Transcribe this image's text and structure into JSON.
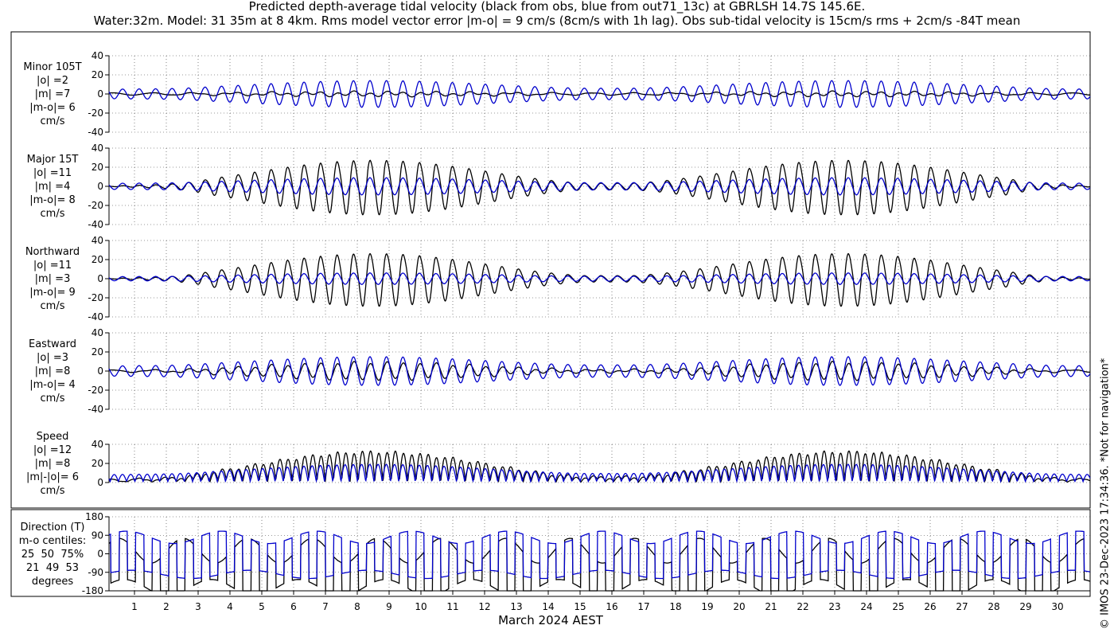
{
  "title_line1": "Predicted depth-average tidal velocity (black from obs, blue from out71_13c) at GBRLSH 14.7S 145.6E.",
  "title_line2": "Water:32m. Model: 31 35m at 8 4km. Rms model vector error |m-o| = 9 cm/s (8cm/s with 1h lag). Obs sub-tidal velocity is 15cm/s rms + 2cm/s -84T mean",
  "credit": "© IMOS 23-Dec-2023 17:34:36. *Not for navigation*",
  "colors": {
    "obs": "#000000",
    "model": "#0000cc",
    "grid": "#333333"
  },
  "chart_data": {
    "type": "line",
    "xlabel": "March 2024 AEST",
    "x_ticks": [
      "1",
      "2",
      "3",
      "4",
      "5",
      "6",
      "7",
      "8",
      "9",
      "10",
      "11",
      "12",
      "13",
      "14",
      "15",
      "16",
      "17",
      "18",
      "19",
      "20",
      "21",
      "22",
      "23",
      "24",
      "25",
      "26",
      "27",
      "28",
      "29",
      "30"
    ],
    "series_names": {
      "obs": "obs",
      "model": "out71_13c"
    },
    "panels": [
      {
        "key": "minor",
        "label": [
          "Minor 105T",
          "|o| =2",
          "|m| =7",
          "|m-o|= 6",
          "cm/s"
        ],
        "ylim": [
          -40,
          40
        ],
        "yticks": [
          "40",
          "20",
          "0",
          "-20",
          "-40"
        ],
        "obs_amp": 2,
        "model_amp": 14
      },
      {
        "key": "major",
        "label": [
          "Major 15T",
          "|o| =11",
          "|m| =4",
          "|m-o|= 8",
          "cm/s"
        ],
        "ylim": [
          -40,
          40
        ],
        "yticks": [
          "40",
          "20",
          "0",
          "-20",
          "-40"
        ],
        "obs_amp": 28,
        "model_amp": 9
      },
      {
        "key": "northward",
        "label": [
          "Northward",
          "|o| =11",
          "|m| =3",
          "|m-o|= 9",
          "cm/s"
        ],
        "ylim": [
          -40,
          40
        ],
        "yticks": [
          "40",
          "20",
          "0",
          "-20",
          "-40"
        ],
        "obs_amp": 27,
        "model_amp": 6
      },
      {
        "key": "eastward",
        "label": [
          "Eastward",
          "|o| =3",
          "|m| =8",
          "|m-o|= 4",
          "cm/s"
        ],
        "ylim": [
          -40,
          40
        ],
        "yticks": [
          "40",
          "20",
          "0",
          "-20",
          "-40"
        ],
        "obs_amp": 9,
        "model_amp": 15
      },
      {
        "key": "speed",
        "label": [
          "Speed",
          "|o| =12",
          "|m| =8",
          "|m|-|o|= 6",
          "cm/s"
        ],
        "ylim": [
          0,
          40
        ],
        "yticks": [
          "40",
          "20",
          "0"
        ],
        "obs_amp": 30,
        "model_amp": 18
      },
      {
        "key": "direction",
        "label": [
          "Direction (T)",
          "m-o centiles:",
          "25  50  75%",
          "21  49  53",
          "degrees"
        ],
        "ylim": [
          -180,
          180
        ],
        "yticks": [
          "180",
          "90",
          "0",
          "-90",
          "-180"
        ]
      }
    ]
  }
}
